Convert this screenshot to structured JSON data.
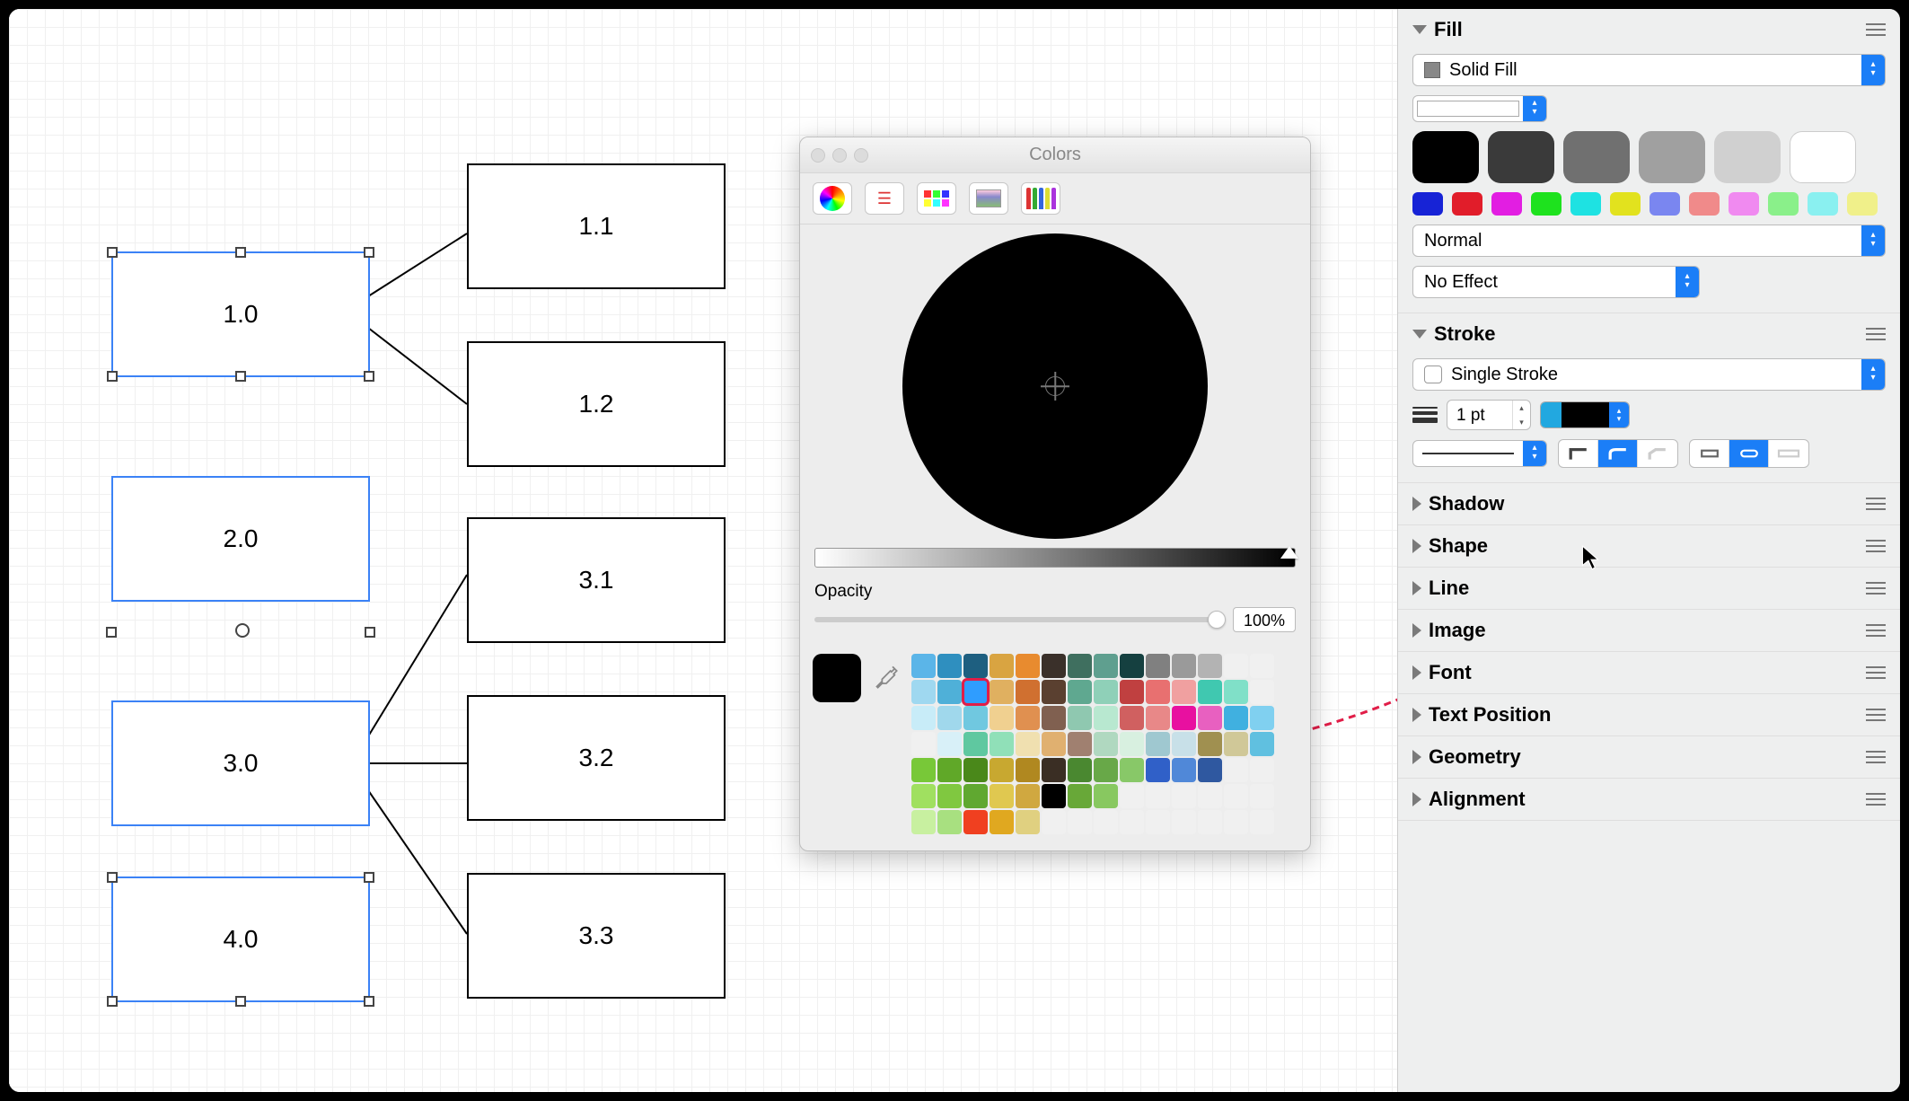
{
  "canvas": {
    "nodes": [
      {
        "label": "1.0"
      },
      {
        "label": "1.1"
      },
      {
        "label": "1.2"
      },
      {
        "label": "2.0"
      },
      {
        "label": "3.0"
      },
      {
        "label": "3.1"
      },
      {
        "label": "3.2"
      },
      {
        "label": "3.3"
      },
      {
        "label": "4.0"
      }
    ]
  },
  "colors_panel": {
    "title": "Colors",
    "opacity_label": "Opacity",
    "opacity_value": "100%"
  },
  "inspector": {
    "fill": {
      "title": "Fill",
      "type_label": "Solid Fill",
      "blend_label": "Normal",
      "effect_label": "No Effect",
      "big_swatches": [
        "#000000",
        "#3a3a3a",
        "#707070",
        "#a0a0a0",
        "#d0d0d0",
        "#ffffff"
      ],
      "small_swatches": [
        "#1723d6",
        "#e11d2a",
        "#e21ee2",
        "#1ee21e",
        "#1ee2e2",
        "#e2e21e",
        "#7a86f0",
        "#f08a8a",
        "#f08af0",
        "#8af08a",
        "#8af0f0",
        "#f0f08a"
      ]
    },
    "stroke": {
      "title": "Stroke",
      "type_label": "Single Stroke",
      "weight": "1 pt"
    },
    "sections": [
      "Shadow",
      "Shape",
      "Line",
      "Image",
      "Font",
      "Text Position",
      "Geometry",
      "Alignment"
    ]
  },
  "swatch_colors": [
    "#5bb5e8",
    "#2f8fbf",
    "#1e5f80",
    "#d9a441",
    "#e88b2f",
    "#3a302a",
    "#3f6f5f",
    "#5f9f8f",
    "#154040",
    "#808080",
    "#9a9a9a",
    "#b3b3b3",
    "#f0f0f0",
    "#f0f0f0",
    "#9fd8f0",
    "#4fb0d8",
    "#2f9dff",
    "#e0b060",
    "#d07030",
    "#5a4030",
    "#5fa890",
    "#8fd0b8",
    "#c04040",
    "#e87070",
    "#f0a0a0",
    "#40c8b0",
    "#80e0c8",
    "#f0f0f0",
    "#c8ecf8",
    "#a0d8ec",
    "#70c8e0",
    "#f0d090",
    "#e09050",
    "#806050",
    "#8fc8b0",
    "#b8e8d0",
    "#d06060",
    "#e88888",
    "#e810a0",
    "#e860c0",
    "#40b0e0",
    "#80d0f0",
    "#f0f0f0",
    "#d8f0f8",
    "#5fc8a0",
    "#90e0b8",
    "#f0e0b0",
    "#e0b070",
    "#a08070",
    "#b0d8c0",
    "#d8f0e0",
    "#9fc8d0",
    "#c8e0e8",
    "#a09050",
    "#d0c898",
    "#60c0e0",
    "#78c838",
    "#60a828",
    "#4a881a",
    "#c8a830",
    "#b08820",
    "#3a2e24",
    "#4a8830",
    "#68a848",
    "#88c868",
    "#3060c8",
    "#5088d8",
    "#2f58a0",
    "#f0f0f0",
    "#f0f0f0",
    "#a0e060",
    "#80c840",
    "#60a830",
    "#e0c850",
    "#d0a840",
    "#000000",
    "#68a838",
    "#88c860",
    "#f0f0f0",
    "#f0f0f0",
    "#f0f0f0",
    "#f0f0f0",
    "#f0f0f0",
    "#f0f0f0",
    "#c8f0a0",
    "#a8e080",
    "#f04020",
    "#e0a820",
    "#e0d080",
    "#f0f0f0",
    "#f0f0f0",
    "#f0f0f0",
    "#f0f0f0",
    "#f0f0f0",
    "#f0f0f0",
    "#f0f0f0",
    "#f0f0f0",
    "#f0f0f0"
  ]
}
